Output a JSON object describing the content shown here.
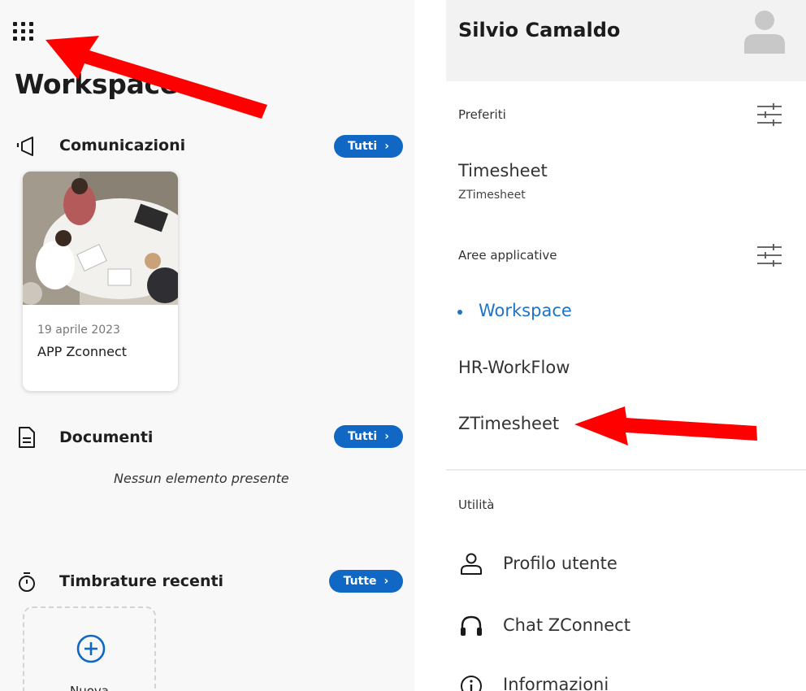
{
  "left": {
    "title": "Workspace",
    "sections": {
      "comunicazioni": {
        "title": "Comunicazioni",
        "button": "Tutti",
        "button_icon": "chevron-right-icon"
      },
      "documenti": {
        "title": "Documenti",
        "button": "Tutti",
        "button_icon": "chevron-right-icon",
        "empty_message": "Nessun elemento presente"
      },
      "timbrature": {
        "title": "Timbrature recenti",
        "button": "Tutte",
        "button_icon": "chevron-right-icon",
        "new_label": "Nuova"
      }
    },
    "card": {
      "date": "19 aprile 2023",
      "name": "APP Zconnect"
    }
  },
  "right": {
    "user_name": "Silvio Camaldo",
    "preferiti": {
      "label": "Preferiti",
      "items": [
        {
          "title": "Timesheet",
          "subtitle": "ZTimesheet"
        }
      ]
    },
    "aree": {
      "label": "Aree applicative",
      "items": [
        "Workspace",
        "HR-WorkFlow",
        "ZTimesheet"
      ],
      "active": "Workspace"
    },
    "utilita": {
      "label": "Utilità",
      "items": [
        {
          "label": "Profilo utente",
          "icon": "user-icon"
        },
        {
          "label": "Chat ZConnect",
          "icon": "headset-icon"
        },
        {
          "label": "Informazioni",
          "icon": "info-icon"
        }
      ]
    }
  },
  "colors": {
    "accent": "#1168c4",
    "active_link": "#1f73c6",
    "annotation_arrow": "#ff0000"
  }
}
